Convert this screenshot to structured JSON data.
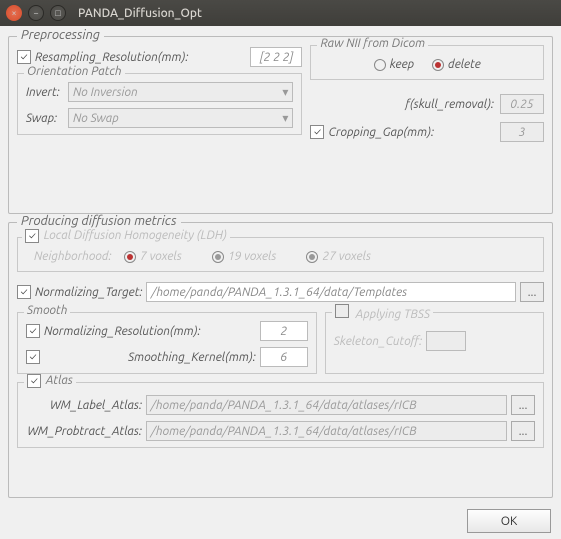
{
  "window": {
    "title": "PANDA_Diffusion_Opt"
  },
  "preprocessing": {
    "legend": "Preprocessing",
    "resampling_label": "Resampling_Resolution(mm):",
    "resampling_value": "[2 2 2]",
    "orientation": {
      "legend": "Orientation Patch",
      "invert_label": "Invert:",
      "invert_value": "No Inversion",
      "swap_label": "Swap:",
      "swap_value": "No Swap"
    },
    "raw_nii": {
      "legend": "Raw NII from Dicom",
      "keep_label": "keep",
      "delete_label": "delete"
    },
    "skull_label": "f(skull_removal):",
    "skull_value": "0.25",
    "cropping_label": "Cropping_Gap(mm):",
    "cropping_value": "3"
  },
  "metrics": {
    "legend": "Producing diffusion metrics",
    "ldh_label": "Local Diffusion Homogeneity (LDH)",
    "neighborhood_label": "Neighborhood:",
    "neigh_7": "7 voxels",
    "neigh_19": "19 voxels",
    "neigh_27": "27 voxels",
    "normalizing_target_label": "Normalizing_Target:",
    "normalizing_target_value": "/home/panda/PANDA_1.3.1_64/data/Templates",
    "smooth": {
      "legend": "Smooth",
      "norm_res_label": "Normalizing_Resolution(mm):",
      "norm_res_value": "2",
      "kernel_label": "Smoothing_Kernel(mm):",
      "kernel_value": "6"
    },
    "tbss": {
      "legend": "Applying TBSS",
      "skeleton_label": "Skeleton_Cutoff:"
    },
    "atlas": {
      "legend": "Atlas",
      "wm_label_label": "WM_Label_Atlas:",
      "wm_label_value": "/home/panda/PANDA_1.3.1_64/data/atlases/rICB",
      "wm_prob_label": "WM_Probtract_Atlas:",
      "wm_prob_value": "/home/panda/PANDA_1.3.1_64/data/atlases/rICB"
    }
  },
  "ok_label": "OK",
  "browse_label": "..."
}
